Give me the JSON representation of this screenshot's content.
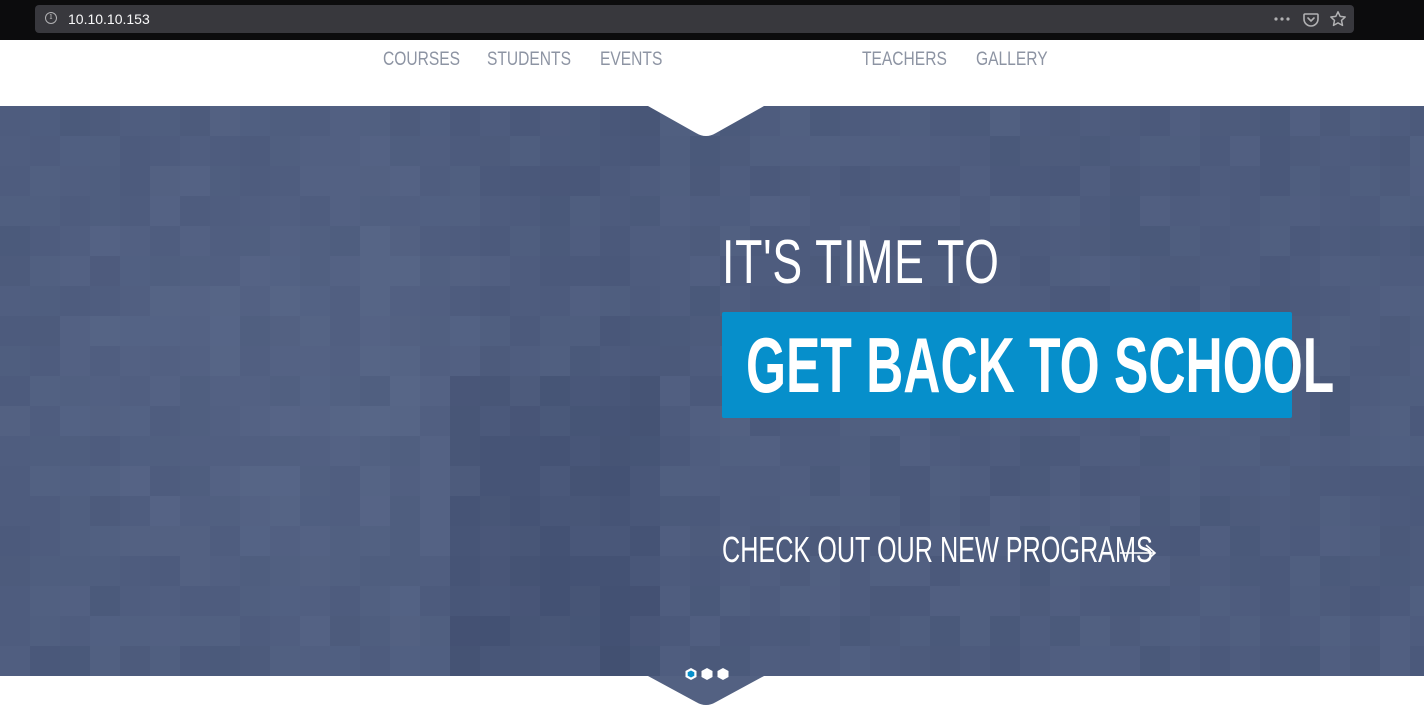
{
  "browser": {
    "url": "10.10.10.153",
    "icons": [
      "info-icon",
      "more-icon",
      "pocket-icon",
      "bookmark-star-icon"
    ]
  },
  "nav": {
    "items": [
      {
        "label": "COURSES"
      },
      {
        "label": "STUDENTS"
      },
      {
        "label": "EVENTS"
      },
      {
        "label": "TEACHERS"
      },
      {
        "label": "GALLERY"
      }
    ]
  },
  "hero": {
    "headline_small": "IT'S TIME TO",
    "headline_big": "GET BACK TO SCHOOL",
    "link": "CHECK OUT OUR NEW PROGRAMS",
    "link_icon": "arrow-right-icon",
    "slides_total": 3,
    "slide_active": 1
  },
  "colors": {
    "hero_overlay": "#536182",
    "accent": "#068fcb",
    "nav_text": "#8d94a3",
    "dot_active": "#068fcb"
  }
}
